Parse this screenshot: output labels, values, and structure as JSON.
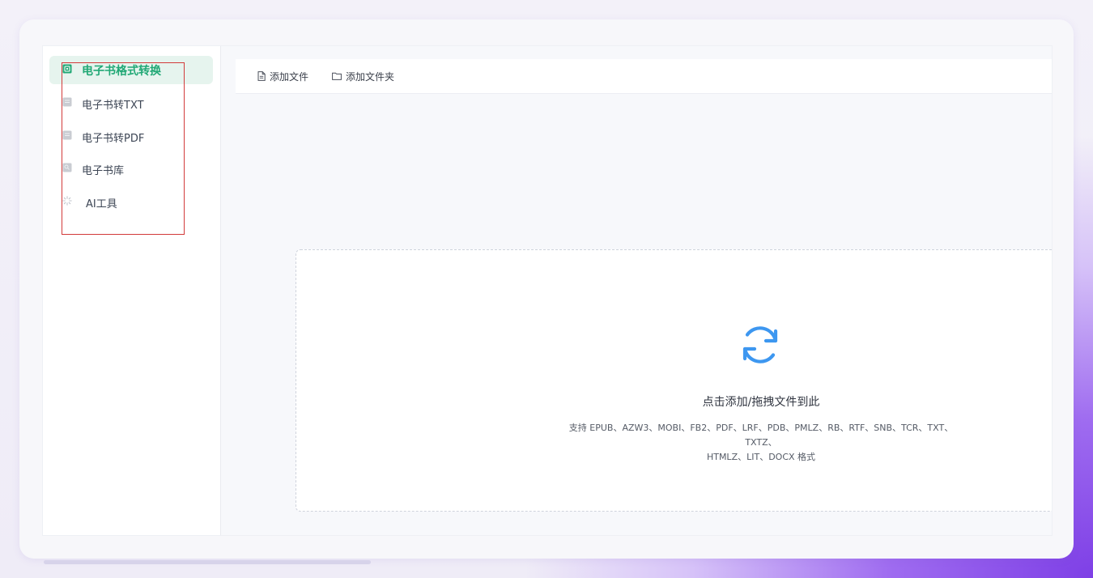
{
  "sidebar": {
    "items": [
      {
        "label": "电子书格式转换",
        "icon": "ebook-convert-icon",
        "active": true
      },
      {
        "label": "电子书转TXT",
        "icon": "document-icon",
        "active": false
      },
      {
        "label": "电子书转PDF",
        "icon": "document-icon",
        "active": false
      },
      {
        "label": "电子书库",
        "icon": "library-icon",
        "active": false
      },
      {
        "label": "AI工具",
        "icon": "sparkle-icon",
        "active": false
      }
    ]
  },
  "toolbar": {
    "add_file_label": "添加文件",
    "add_folder_label": "添加文件夹"
  },
  "drop_zone": {
    "icon": "refresh-icon",
    "title": "点击添加/拖拽文件到此",
    "formats_line1": "支持 EPUB、AZW3、MOBI、FB2、PDF、LRF、PDB、PMLZ、RB、RTF、SNB、TCR、TXT、TXTZ、",
    "formats_line2": "HTMLZ、LIT、DOCX 格式"
  },
  "colors": {
    "accent": "#21a875",
    "active_bg": "#e6f4ee",
    "icon_blue": "#3d97f0",
    "highlight": "#d23a3a"
  }
}
